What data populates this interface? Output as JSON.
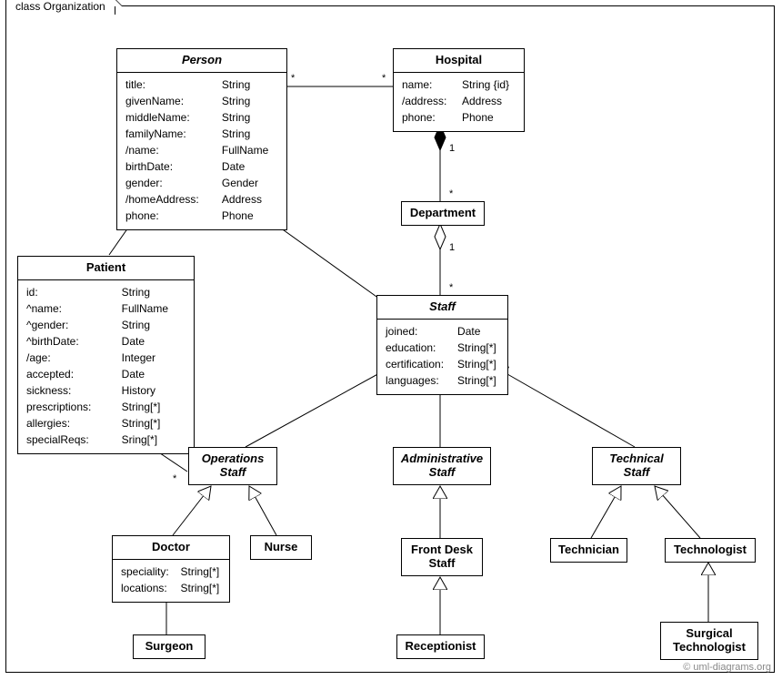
{
  "frame": {
    "label": "class Organization"
  },
  "classes": {
    "person": {
      "title": "Person",
      "attrs": [
        [
          "title:",
          "String"
        ],
        [
          "givenName:",
          "String"
        ],
        [
          "middleName:",
          "String"
        ],
        [
          "familyName:",
          "String"
        ],
        [
          "/name:",
          "FullName"
        ],
        [
          "birthDate:",
          "Date"
        ],
        [
          "gender:",
          "Gender"
        ],
        [
          "/homeAddress:",
          "Address"
        ],
        [
          "phone:",
          "Phone"
        ]
      ]
    },
    "hospital": {
      "title": "Hospital",
      "attrs": [
        [
          "name:",
          "String {id}"
        ],
        [
          "/address:",
          "Address"
        ],
        [
          "phone:",
          "Phone"
        ]
      ]
    },
    "department": {
      "title": "Department"
    },
    "patient": {
      "title": "Patient",
      "attrs": [
        [
          "id:",
          "String"
        ],
        [
          "^name:",
          "FullName"
        ],
        [
          "^gender:",
          "String"
        ],
        [
          "^birthDate:",
          "Date"
        ],
        [
          "/age:",
          "Integer"
        ],
        [
          "accepted:",
          "Date"
        ],
        [
          "sickness:",
          "History"
        ],
        [
          "prescriptions:",
          "String[*]"
        ],
        [
          "allergies:",
          "String[*]"
        ],
        [
          "specialReqs:",
          "Sring[*]"
        ]
      ]
    },
    "staff": {
      "title": "Staff",
      "attrs": [
        [
          "joined:",
          "Date"
        ],
        [
          "education:",
          "String[*]"
        ],
        [
          "certification:",
          "String[*]"
        ],
        [
          "languages:",
          "String[*]"
        ]
      ]
    },
    "operationsStaff": {
      "title": "Operations<br>Staff"
    },
    "administrativeStaff": {
      "title": "Administrative<br>Staff"
    },
    "technicalStaff": {
      "title": "Technical<br>Staff"
    },
    "doctor": {
      "title": "Doctor",
      "attrs": [
        [
          "speciality:",
          "String[*]"
        ],
        [
          "locations:",
          "String[*]"
        ]
      ]
    },
    "nurse": {
      "title": "Nurse"
    },
    "frontDeskStaff": {
      "title": "Front Desk<br>Staff"
    },
    "technician": {
      "title": "Technician"
    },
    "technologist": {
      "title": "Technologist"
    },
    "surgeon": {
      "title": "Surgeon"
    },
    "receptionist": {
      "title": "Receptionist"
    },
    "surgicalTechnologist": {
      "title": "Surgical<br>Technologist"
    }
  },
  "mult": {
    "person_assoc_left": "*",
    "person_assoc_right": "*",
    "hosp_dept_top": "1",
    "hosp_dept_bottom": "*",
    "dept_staff_top": "1",
    "dept_staff_bottom": "*",
    "patient_ops_top": "*",
    "patient_ops_bottom": "*"
  },
  "footer": "© uml-diagrams.org"
}
